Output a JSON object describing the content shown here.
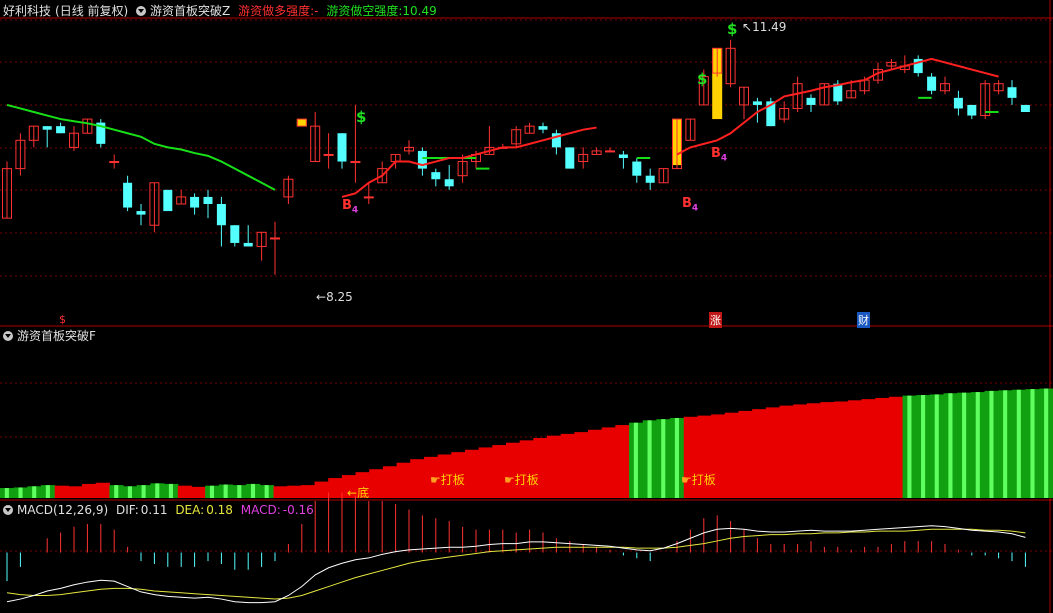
{
  "main_panel": {
    "stock_name": "好利科技",
    "period": "(日线 前复权)",
    "indicator_name": "游资首板突破Z",
    "long_strength_label": "游资做多强度:",
    "long_strength_value": "-",
    "short_strength_label": "游资做空强度:",
    "short_strength_value": "10.49",
    "high_marker": "11.49",
    "low_marker": "8.25",
    "bottom_tags": [
      "$",
      "涨",
      "财"
    ],
    "signal_dollar": "$",
    "signal_b": "B",
    "signal_b_sub": "4"
  },
  "mid_panel": {
    "indicator_name": "游资首板突破F",
    "bottom_label": "底",
    "board_label": "打板"
  },
  "macd_panel": {
    "title": "MACD(12,26,9)",
    "dif_label": "DIF:",
    "dif_value": "0.11",
    "dea_label": "DEA:",
    "dea_value": "0.18",
    "macd_label": "MACD:",
    "macd_value": "-0.16"
  },
  "colors": {
    "up": "#ff3232",
    "down": "#54ffff",
    "ma_green": "#18e018",
    "ma_red": "#ff2020",
    "highlight": "#ffd200",
    "macd_purple": "#e040e0",
    "dea_yellow": "#e6e640",
    "grid": "#7a0000"
  },
  "chart_data": {
    "type": "candlestick",
    "price_range": [
      7.9,
      11.8
    ],
    "candles": [
      [
        9.0,
        9.7,
        9.0,
        9.8
      ],
      [
        9.7,
        10.1,
        9.6,
        10.2
      ],
      [
        10.1,
        10.3,
        10.0,
        10.3
      ],
      [
        10.3,
        10.25,
        10.0,
        10.3
      ],
      [
        10.3,
        10.2,
        10.2,
        10.35
      ],
      [
        10.0,
        10.2,
        9.95,
        10.3
      ],
      [
        10.2,
        10.4,
        10.2,
        10.4
      ],
      [
        10.35,
        10.05,
        10.0,
        10.4
      ],
      [
        9.8,
        9.8,
        9.7,
        9.9
      ],
      [
        9.5,
        9.15,
        9.1,
        9.6
      ],
      [
        9.1,
        9.05,
        8.9,
        9.2
      ],
      [
        8.9,
        9.5,
        8.8,
        9.5
      ],
      [
        9.4,
        9.1,
        9.1,
        9.4
      ],
      [
        9.2,
        9.3,
        9.2,
        9.4
      ],
      [
        9.3,
        9.15,
        9.05,
        9.35
      ],
      [
        9.3,
        9.2,
        9.0,
        9.4
      ],
      [
        9.2,
        8.9,
        8.6,
        9.3
      ],
      [
        8.9,
        8.65,
        8.6,
        8.9
      ],
      [
        8.65,
        8.6,
        8.6,
        8.9
      ],
      [
        8.6,
        8.8,
        8.4,
        8.8
      ],
      [
        8.72,
        8.72,
        8.2,
        8.95
      ],
      [
        9.3,
        9.55,
        9.2,
        9.6
      ],
      [
        10.3,
        10.4,
        10.4,
        10.4
      ],
      [
        9.8,
        10.3,
        9.8,
        10.5
      ],
      [
        9.9,
        9.9,
        9.7,
        10.2
      ],
      [
        10.2,
        9.8,
        9.7,
        10.2
      ],
      [
        9.8,
        9.8,
        9.5,
        10.6
      ],
      [
        9.3,
        9.3,
        9.2,
        9.5
      ],
      [
        9.5,
        9.7,
        9.5,
        9.8
      ],
      [
        9.8,
        9.9,
        9.7,
        9.9
      ],
      [
        9.95,
        10.0,
        9.9,
        10.1
      ],
      [
        9.95,
        9.7,
        9.6,
        10.0
      ],
      [
        9.65,
        9.55,
        9.45,
        9.7
      ],
      [
        9.55,
        9.45,
        9.4,
        9.75
      ],
      [
        9.6,
        9.8,
        9.5,
        9.9
      ],
      [
        9.8,
        9.9,
        9.7,
        9.95
      ],
      [
        9.9,
        10.0,
        9.9,
        10.3
      ],
      [
        10.0,
        10.0,
        10.0,
        10.05
      ],
      [
        10.05,
        10.25,
        10.0,
        10.3
      ],
      [
        10.2,
        10.3,
        10.2,
        10.35
      ],
      [
        10.3,
        10.25,
        10.2,
        10.35
      ],
      [
        10.2,
        10.0,
        9.9,
        10.25
      ],
      [
        10.0,
        9.7,
        9.7,
        10.0
      ],
      [
        9.8,
        9.9,
        9.7,
        10.0
      ],
      [
        9.9,
        9.95,
        9.9,
        10.0
      ],
      [
        9.95,
        9.95,
        9.95,
        10.0
      ],
      [
        9.9,
        9.85,
        9.7,
        9.95
      ],
      [
        9.8,
        9.6,
        9.5,
        9.85
      ],
      [
        9.6,
        9.5,
        9.4,
        9.7
      ],
      [
        9.5,
        9.7,
        9.5,
        9.7
      ],
      [
        9.7,
        10.4,
        9.7,
        10.4
      ],
      [
        10.1,
        10.4,
        10.1,
        10.4
      ],
      [
        10.6,
        11.0,
        10.6,
        11.1
      ],
      [
        11.05,
        11.4,
        11.0,
        11.4
      ],
      [
        10.9,
        11.4,
        10.85,
        11.52
      ],
      [
        10.6,
        10.85,
        10.4,
        10.85
      ],
      [
        10.65,
        10.6,
        10.35,
        10.7
      ],
      [
        10.65,
        10.3,
        10.3,
        10.7
      ],
      [
        10.4,
        10.55,
        10.35,
        10.65
      ],
      [
        10.55,
        10.9,
        10.5,
        11.0
      ],
      [
        10.7,
        10.6,
        10.5,
        10.75
      ],
      [
        10.6,
        10.9,
        10.6,
        10.9
      ],
      [
        10.9,
        10.65,
        10.6,
        10.95
      ],
      [
        10.7,
        10.8,
        10.7,
        10.95
      ],
      [
        10.8,
        10.95,
        10.75,
        11.0
      ],
      [
        10.95,
        11.1,
        10.9,
        11.2
      ],
      [
        11.15,
        11.2,
        11.1,
        11.25
      ],
      [
        11.1,
        11.15,
        11.05,
        11.3
      ],
      [
        11.25,
        11.05,
        11.0,
        11.3
      ],
      [
        11.0,
        10.8,
        10.75,
        11.05
      ],
      [
        10.8,
        10.9,
        10.75,
        11.0
      ],
      [
        10.7,
        10.55,
        10.45,
        10.8
      ],
      [
        10.6,
        10.45,
        10.4,
        10.6
      ],
      [
        10.45,
        10.9,
        10.4,
        10.95
      ],
      [
        10.8,
        10.9,
        10.75,
        10.95
      ],
      [
        10.85,
        10.7,
        10.6,
        10.95
      ],
      [
        10.6,
        10.5,
        10.5,
        10.6
      ]
    ],
    "ma_green": [
      [
        10.6,
        10.55,
        10.5,
        10.45,
        10.4,
        10.37,
        10.34,
        10.3,
        10.25,
        10.2,
        10.15,
        10.05,
        10.0,
        9.97,
        9.92,
        9.88,
        9.8,
        9.7,
        9.6,
        9.5,
        9.4
      ],
      [
        9.85,
        9.85,
        9.85,
        9.85,
        9.85
      ],
      [
        9.7,
        9.7
      ],
      [
        9.85,
        9.85
      ],
      [
        10.7,
        10.7
      ],
      [
        10.5,
        10.5
      ]
    ],
    "ma_red": [
      [
        9.3,
        9.35,
        9.5,
        9.6,
        9.8,
        9.8,
        9.75,
        9.8,
        9.85,
        9.85,
        9.9,
        9.95,
        10.0,
        10.0,
        10.05,
        10.1,
        10.15,
        10.2,
        10.25,
        10.28
      ],
      [
        9.9,
        10.0,
        10.05,
        10.1,
        10.2,
        10.35,
        10.5,
        10.6,
        10.72,
        10.76,
        10.8,
        10.85,
        10.88,
        10.92,
        10.95,
        11.05,
        11.1,
        11.15,
        11.2,
        11.25,
        11.2,
        11.15,
        11.1,
        11.05,
        11.0
      ]
    ],
    "f_curve": [
      5,
      6,
      8,
      10,
      9,
      8,
      12,
      14,
      10,
      8,
      10,
      13,
      12,
      9,
      7,
      9,
      11,
      10,
      12,
      10,
      8,
      9,
      10,
      16,
      22,
      27,
      32,
      37,
      42,
      48,
      54,
      58,
      62,
      66,
      70,
      74,
      78,
      82,
      86,
      90,
      94,
      97,
      100,
      104,
      108,
      112,
      116,
      120,
      122,
      124,
      126,
      128,
      130,
      133,
      136,
      139,
      142,
      145,
      147,
      149,
      151,
      152,
      154,
      156,
      158,
      160,
      162,
      163,
      164,
      166,
      167,
      168,
      170,
      171,
      172,
      173,
      174
    ],
    "f_green_segments": [
      [
        0,
        3
      ],
      [
        8,
        12
      ],
      [
        15,
        19
      ],
      [
        46,
        49
      ],
      [
        66,
        76
      ]
    ],
    "dif": [
      -0.55,
      -0.52,
      -0.48,
      -0.43,
      -0.4,
      -0.36,
      -0.33,
      -0.31,
      -0.32,
      -0.38,
      -0.44,
      -0.47,
      -0.49,
      -0.5,
      -0.51,
      -0.5,
      -0.52,
      -0.55,
      -0.56,
      -0.56,
      -0.55,
      -0.48,
      -0.38,
      -0.25,
      -0.17,
      -0.12,
      -0.08,
      -0.06,
      -0.02,
      0.01,
      0.03,
      0.04,
      0.05,
      0.06,
      0.06,
      0.07,
      0.09,
      0.1,
      0.1,
      0.12,
      0.12,
      0.11,
      0.1,
      0.09,
      0.08,
      0.07,
      0.05,
      0.03,
      0.02,
      0.05,
      0.1,
      0.16,
      0.22,
      0.26,
      0.27,
      0.26,
      0.24,
      0.23,
      0.23,
      0.24,
      0.25,
      0.24,
      0.24,
      0.24,
      0.25,
      0.26,
      0.27,
      0.28,
      0.29,
      0.3,
      0.29,
      0.27,
      0.25,
      0.24,
      0.23,
      0.21,
      0.17
    ],
    "dea": [
      -0.45,
      -0.47,
      -0.48,
      -0.48,
      -0.47,
      -0.45,
      -0.43,
      -0.41,
      -0.4,
      -0.4,
      -0.41,
      -0.43,
      -0.44,
      -0.45,
      -0.46,
      -0.47,
      -0.48,
      -0.49,
      -0.5,
      -0.51,
      -0.52,
      -0.51,
      -0.48,
      -0.43,
      -0.38,
      -0.33,
      -0.28,
      -0.24,
      -0.2,
      -0.16,
      -0.12,
      -0.09,
      -0.07,
      -0.05,
      -0.03,
      -0.01,
      0.01,
      0.02,
      0.03,
      0.04,
      0.05,
      0.06,
      0.06,
      0.06,
      0.06,
      0.06,
      0.06,
      0.05,
      0.05,
      0.05,
      0.06,
      0.08,
      0.1,
      0.13,
      0.16,
      0.18,
      0.19,
      0.2,
      0.2,
      0.21,
      0.21,
      0.22,
      0.22,
      0.23,
      0.23,
      0.24,
      0.24,
      0.24,
      0.25,
      0.26,
      0.26,
      0.26,
      0.26,
      0.25,
      0.25,
      0.24,
      0.22
    ],
    "macd_range": [
      -0.62,
      0.42
    ]
  }
}
